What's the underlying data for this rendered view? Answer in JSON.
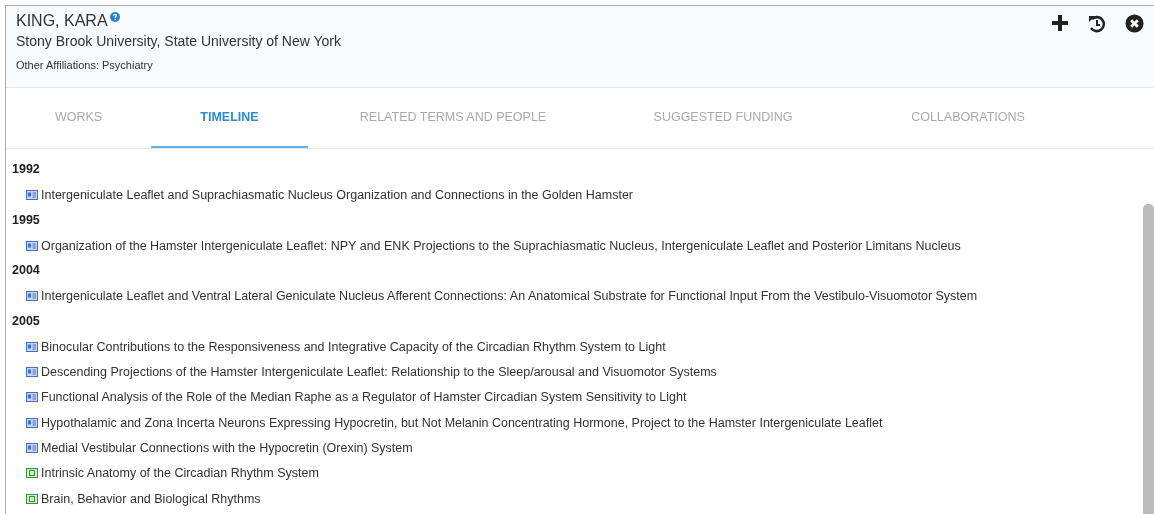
{
  "profile": {
    "name": "KING, KARA",
    "institution": "Stony Brook University, State University of New York",
    "affiliations": "Other Affiliations: Psychiatry"
  },
  "tabs": [
    {
      "label": "WORKS",
      "selected": false
    },
    {
      "label": "TIMELINE",
      "selected": true
    },
    {
      "label": "RELATED TERMS AND PEOPLE",
      "selected": false
    },
    {
      "label": "SUGGESTED FUNDING",
      "selected": false
    },
    {
      "label": "COLLABORATIONS",
      "selected": false
    }
  ],
  "timeline": [
    {
      "year": "1992",
      "items": [
        {
          "kind": "article",
          "title": "Intergeniculate Leaflet and Suprachiasmatic Nucleus Organization and Connections in the Golden Hamster"
        }
      ]
    },
    {
      "year": "1995",
      "items": [
        {
          "kind": "article",
          "title": "Organization of the Hamster Intergeniculate Leaflet: NPY and ENK Projections to the Suprachiasmatic Nucleus, Intergeniculate Leaflet and Posterior Limitans Nucleus"
        }
      ]
    },
    {
      "year": "2004",
      "items": [
        {
          "kind": "article",
          "title": "Intergeniculate Leaflet and Ventral Lateral Geniculate Nucleus Afferent Connections: An Anatomical Substrate for Functional Input From the Vestibulo-Visuomotor System"
        }
      ]
    },
    {
      "year": "2005",
      "items": [
        {
          "kind": "article",
          "title": "Binocular Contributions to the Responsiveness and Integrative Capacity of the Circadian Rhythm System to Light"
        },
        {
          "kind": "article",
          "title": "Descending Projections of the Hamster Intergeniculate Leaflet: Relationship to the Sleep/arousal and Visuomotor Systems"
        },
        {
          "kind": "article",
          "title": "Functional Analysis of the Role of the Median Raphe as a Regulator of Hamster Circadian System Sensitivity to Light"
        },
        {
          "kind": "article",
          "title": "Hypothalamic and Zona Incerta Neurons Expressing Hypocretin, but Not Melanin Concentrating Hormone, Project to the Hamster Intergeniculate Leaflet"
        },
        {
          "kind": "article",
          "title": "Medial Vestibular Connections with the Hypocretin (Orexin) System"
        },
        {
          "kind": "book",
          "title": "Intrinsic Anatomy of the Circadian Rhythm System"
        },
        {
          "kind": "book",
          "title": "Brain, Behavior and Biological Rhythms"
        }
      ]
    }
  ]
}
